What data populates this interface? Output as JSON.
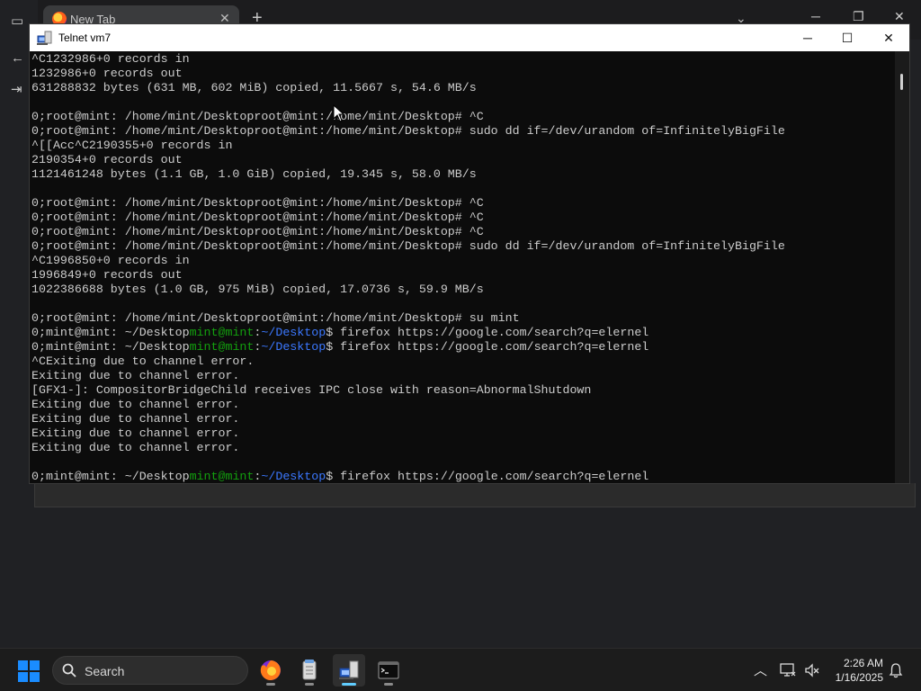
{
  "browser": {
    "tab_label": "New Tab",
    "tab_close": "✕",
    "new_tab": "+",
    "chevron": "⌄",
    "minimize": "─",
    "restore": "❐",
    "close": "✕"
  },
  "telnet": {
    "title": "Telnet vm7",
    "minimize": "─",
    "maximize": "☐",
    "close": "✕",
    "lines": [
      [
        {
          "t": "^C1232986+0 records in"
        }
      ],
      [
        {
          "t": "1232986+0 records out"
        }
      ],
      [
        {
          "t": "631288832 bytes (631 MB, 602 MiB) copied, 11.5667 s, 54.6 MB/s"
        }
      ],
      [
        {
          "t": ""
        }
      ],
      [
        {
          "t": "0;root@mint: /home/mint/Desktoproot@mint:/home/mint/Desktop# ^C"
        }
      ],
      [
        {
          "t": "0;root@mint: /home/mint/Desktoproot@mint:/home/mint/Desktop# sudo dd if=/dev/urandom of=InfinitelyBigFile"
        }
      ],
      [
        {
          "t": "^[[Acc^C2190355+0 records in"
        }
      ],
      [
        {
          "t": "2190354+0 records out"
        }
      ],
      [
        {
          "t": "1121461248 bytes (1.1 GB, 1.0 GiB) copied, 19.345 s, 58.0 MB/s"
        }
      ],
      [
        {
          "t": ""
        }
      ],
      [
        {
          "t": "0;root@mint: /home/mint/Desktoproot@mint:/home/mint/Desktop# ^C"
        }
      ],
      [
        {
          "t": "0;root@mint: /home/mint/Desktoproot@mint:/home/mint/Desktop# ^C"
        }
      ],
      [
        {
          "t": "0;root@mint: /home/mint/Desktoproot@mint:/home/mint/Desktop# ^C"
        }
      ],
      [
        {
          "t": "0;root@mint: /home/mint/Desktoproot@mint:/home/mint/Desktop# sudo dd if=/dev/urandom of=InfinitelyBigFile"
        }
      ],
      [
        {
          "t": "^C1996850+0 records in"
        }
      ],
      [
        {
          "t": "1996849+0 records out"
        }
      ],
      [
        {
          "t": "1022386688 bytes (1.0 GB, 975 MiB) copied, 17.0736 s, 59.9 MB/s"
        }
      ],
      [
        {
          "t": ""
        }
      ],
      [
        {
          "t": "0;root@mint: /home/mint/Desktoproot@mint:/home/mint/Desktop# su mint"
        }
      ],
      [
        {
          "t": "0;mint@mint: ~/Desktop"
        },
        {
          "t": "mint@mint",
          "c": "green"
        },
        {
          "t": ":"
        },
        {
          "t": "~/Desktop",
          "c": "blue"
        },
        {
          "t": "$ firefox https://google.com/search?q=elernel"
        }
      ],
      [
        {
          "t": "0;mint@mint: ~/Desktop"
        },
        {
          "t": "mint@mint",
          "c": "green"
        },
        {
          "t": ":"
        },
        {
          "t": "~/Desktop",
          "c": "blue"
        },
        {
          "t": "$ firefox https://google.com/search?q=elernel"
        }
      ],
      [
        {
          "t": "^CExiting due to channel error."
        }
      ],
      [
        {
          "t": "Exiting due to channel error."
        }
      ],
      [
        {
          "t": "[GFX1-]: CompositorBridgeChild receives IPC close with reason=AbnormalShutdown"
        }
      ],
      [
        {
          "t": "Exiting due to channel error."
        }
      ],
      [
        {
          "t": "Exiting due to channel error."
        }
      ],
      [
        {
          "t": "Exiting due to channel error."
        }
      ],
      [
        {
          "t": "Exiting due to channel error."
        }
      ],
      [
        {
          "t": ""
        }
      ],
      [
        {
          "t": "0;mint@mint: ~/Desktop"
        },
        {
          "t": "mint@mint",
          "c": "green"
        },
        {
          "t": ":"
        },
        {
          "t": "~/Desktop",
          "c": "blue"
        },
        {
          "t": "$ firefox https://google.com/search?q=elernel"
        }
      ]
    ],
    "scroll_position": 0.03
  },
  "taskbar": {
    "search_label": "Search",
    "time": "2:26 AM",
    "date": "1/16/2025",
    "apps": [
      "firefox-icon",
      "notepad-icon",
      "telnet-icon",
      "terminal-icon"
    ],
    "active_app": "telnet-icon",
    "colors": {
      "accent": "#60cdff",
      "start": "#0a84ff"
    }
  },
  "colors": {
    "terminal_bg": "#0c0c0c",
    "terminal_fg": "#cccccc",
    "prompt_user": "#13a10e",
    "prompt_path": "#3b78ff"
  }
}
